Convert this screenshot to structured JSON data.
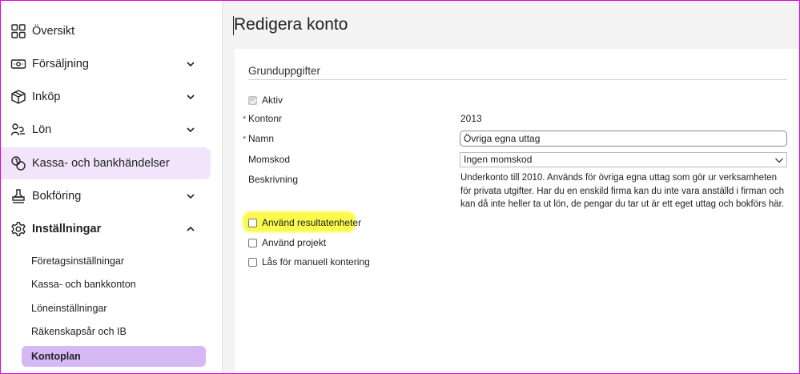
{
  "sidebar": {
    "items": [
      {
        "label": "Översikt",
        "icon": "grid-icon"
      },
      {
        "label": "Försäljning",
        "icon": "cash-icon"
      },
      {
        "label": "Inköp",
        "icon": "box-icon"
      },
      {
        "label": "Lön",
        "icon": "users-icon"
      },
      {
        "label": "Kassa- och bankhändelser",
        "icon": "coins-icon"
      },
      {
        "label": "Bokföring",
        "icon": "stamp-icon"
      },
      {
        "label": "Inställningar",
        "icon": "gear-icon"
      }
    ],
    "sub_items": [
      {
        "label": "Företagsinställningar"
      },
      {
        "label": "Kassa- och bankkonton"
      },
      {
        "label": "Löneinställningar"
      },
      {
        "label": "Räkenskapsår och IB"
      },
      {
        "label": "Kontoplan"
      }
    ],
    "accent_active_bg": "#f1e4fb",
    "accent_selected_bg": "#d6b8f5"
  },
  "main": {
    "title": "Redigera konto",
    "section_title": "Grunduppgifter",
    "aktiv": {
      "label": "Aktiv",
      "checked": true
    },
    "fields": {
      "kontonr": {
        "label": "Kontonr",
        "value": "2013"
      },
      "namn": {
        "label": "Namn",
        "value": "Övriga egna uttag"
      },
      "momskod": {
        "label": "Momskod",
        "value": "Ingen momskod"
      },
      "beskrivning": {
        "label": "Beskrivning",
        "value": "Underkonto till 2010. Används för övriga egna uttag som gör ur verksamheten för privata utgifter. Har du en enskild firma kan du inte vara anställd i firman och kan då inte heller ta ut lön, de pengar du tar ut är ett eget uttag och bokförs här."
      }
    },
    "checkboxes": [
      {
        "label": "Använd resultatenheter",
        "checked": false,
        "highlighted": true
      },
      {
        "label": "Använd projekt",
        "checked": false
      },
      {
        "label": "Lås för manuell kontering",
        "checked": false
      }
    ],
    "required_marker": "*"
  }
}
